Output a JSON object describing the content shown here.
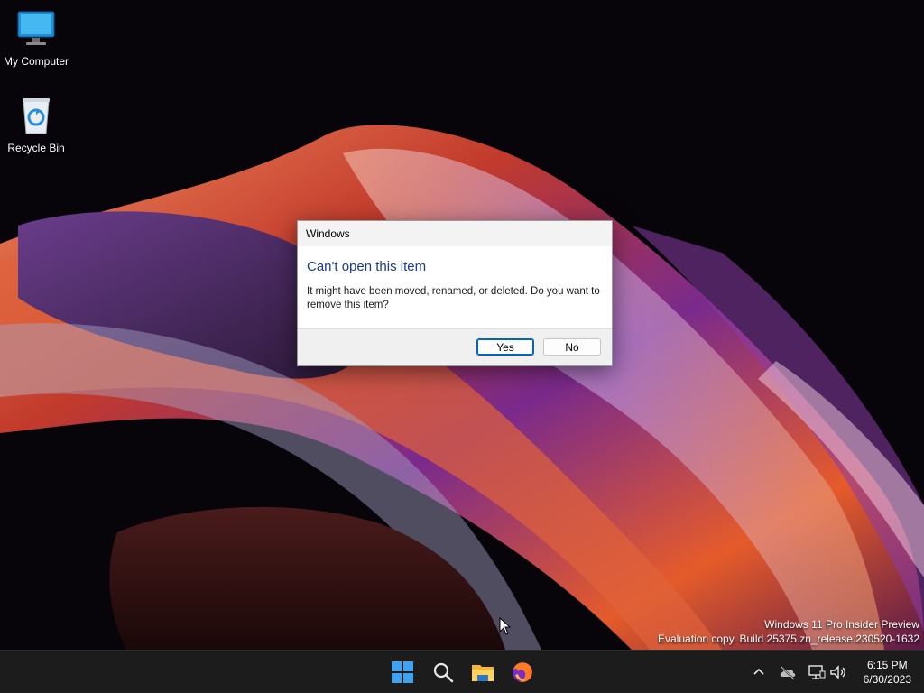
{
  "desktop": {
    "icons": [
      {
        "label": "My Computer",
        "icon": "monitor-icon"
      },
      {
        "label": "Recycle Bin",
        "icon": "recycle-bin-icon"
      }
    ],
    "watermark": {
      "line1": "Windows 11 Pro Insider Preview",
      "line2": "Evaluation copy. Build 25375.zn_release.230520-1632"
    }
  },
  "dialog": {
    "title": "Windows",
    "heading": "Can't open this item",
    "message": "It might have been moved, renamed, or deleted. Do you want to remove this item?",
    "yes_label": "Yes",
    "no_label": "No",
    "accent_color": "#0067c0",
    "heading_color": "#1c3a8a"
  },
  "taskbar": {
    "apps": [
      {
        "name": "Start",
        "icon": "windows-start-icon"
      },
      {
        "name": "Search",
        "icon": "search-icon"
      },
      {
        "name": "File Explorer",
        "icon": "folder-icon"
      },
      {
        "name": "Firefox",
        "icon": "firefox-icon"
      }
    ],
    "tray": [
      "chevron-up-icon",
      "cloud-offline-icon",
      "network-icon",
      "volume-icon"
    ],
    "clock": {
      "time": "6:15 PM",
      "date": "6/30/2023"
    }
  }
}
